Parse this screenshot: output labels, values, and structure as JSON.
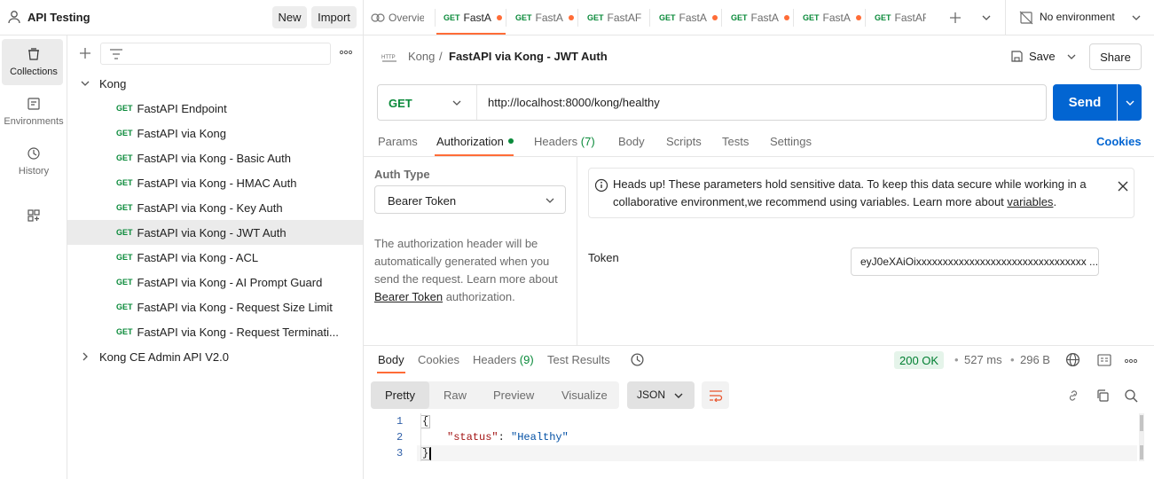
{
  "workspace": {
    "name": "API Testing",
    "new_label": "New",
    "import_label": "Import"
  },
  "tabs": [
    {
      "label": "Overvie",
      "type": "overview"
    },
    {
      "method": "GET",
      "label": "FastA",
      "dirty": true,
      "active": true
    },
    {
      "method": "GET",
      "label": "FastA",
      "dirty": true
    },
    {
      "method": "GET",
      "label": "FastAF",
      "dirty": false
    },
    {
      "method": "GET",
      "label": "FastA",
      "dirty": true
    },
    {
      "method": "GET",
      "label": "FastA",
      "dirty": true
    },
    {
      "method": "GET",
      "label": "FastA",
      "dirty": true
    },
    {
      "method": "GET",
      "label": "FastAF",
      "dirty": false
    }
  ],
  "environment": {
    "label": "No environment"
  },
  "leftnav": [
    {
      "label": "Collections",
      "icon": "collections-icon",
      "active": true
    },
    {
      "label": "Environments",
      "icon": "environments-icon"
    },
    {
      "label": "History",
      "icon": "history-icon"
    },
    {
      "label": "",
      "icon": "add-apps-icon"
    }
  ],
  "tree": {
    "folder": "Kong",
    "items": [
      {
        "method": "GET",
        "label": "FastAPI Endpoint"
      },
      {
        "method": "GET",
        "label": "FastAPI via Kong"
      },
      {
        "method": "GET",
        "label": "FastAPI via Kong - Basic Auth"
      },
      {
        "method": "GET",
        "label": "FastAPI via Kong - HMAC Auth"
      },
      {
        "method": "GET",
        "label": "FastAPI via Kong - Key Auth"
      },
      {
        "method": "GET",
        "label": "FastAPI via Kong - JWT Auth",
        "selected": true
      },
      {
        "method": "GET",
        "label": "FastAPI via Kong - ACL"
      },
      {
        "method": "GET",
        "label": "FastAPI via Kong - AI Prompt Guard"
      },
      {
        "method": "GET",
        "label": "FastAPI via Kong - Request Size Limit"
      },
      {
        "method": "GET",
        "label": "FastAPI via Kong - Request Terminati..."
      }
    ],
    "folder2": "Kong CE Admin API V2.0"
  },
  "request": {
    "breadcrumb_parent": "Kong",
    "separator": "/",
    "title": "FastAPI via Kong - JWT Auth",
    "save_label": "Save",
    "share_label": "Share",
    "method": "GET",
    "url": "http://localhost:8000/kong/healthy",
    "send_label": "Send",
    "tabs": {
      "params": "Params",
      "authorization": "Authorization",
      "headers": "Headers",
      "headers_count": "(7)",
      "body": "Body",
      "scripts": "Scripts",
      "tests": "Tests",
      "settings": "Settings",
      "cookies": "Cookies"
    }
  },
  "auth": {
    "type_label": "Auth Type",
    "type_value": "Bearer Token",
    "desc_1": "The authorization header will be automatically generated when you send the request. Learn more about ",
    "desc_link": "Bearer Token",
    "desc_2": " authorization.",
    "alert_1": "Heads up! These parameters hold sensitive data. To keep this data secure while working in a collaborative environment,we recommend using variables. Learn more about ",
    "alert_link": "variables",
    "alert_2": ".",
    "token_label": "Token",
    "token_value": "eyJ0eXAiOixxxxxxxxxxxxxxxxxxxxxxxxxxxxxxxx ..."
  },
  "response": {
    "tabs": {
      "body": "Body",
      "cookies": "Cookies",
      "headers": "Headers",
      "headers_count": "(9)",
      "test_results": "Test Results"
    },
    "status": "200 OK",
    "time": "527 ms",
    "size": "296 B",
    "view": {
      "pretty": "Pretty",
      "raw": "Raw",
      "preview": "Preview",
      "visualize": "Visualize",
      "format": "JSON"
    },
    "lines": [
      {
        "n": "1",
        "text": "{"
      },
      {
        "n": "2",
        "key": "\"status\"",
        "colon": ": ",
        "value": "\"Healthy\""
      },
      {
        "n": "3",
        "text": "}"
      }
    ]
  },
  "colors": {
    "accent": "#ff6c37",
    "send": "#0265d2",
    "get": "#0a8a3a",
    "status_ok": "#007f31"
  }
}
